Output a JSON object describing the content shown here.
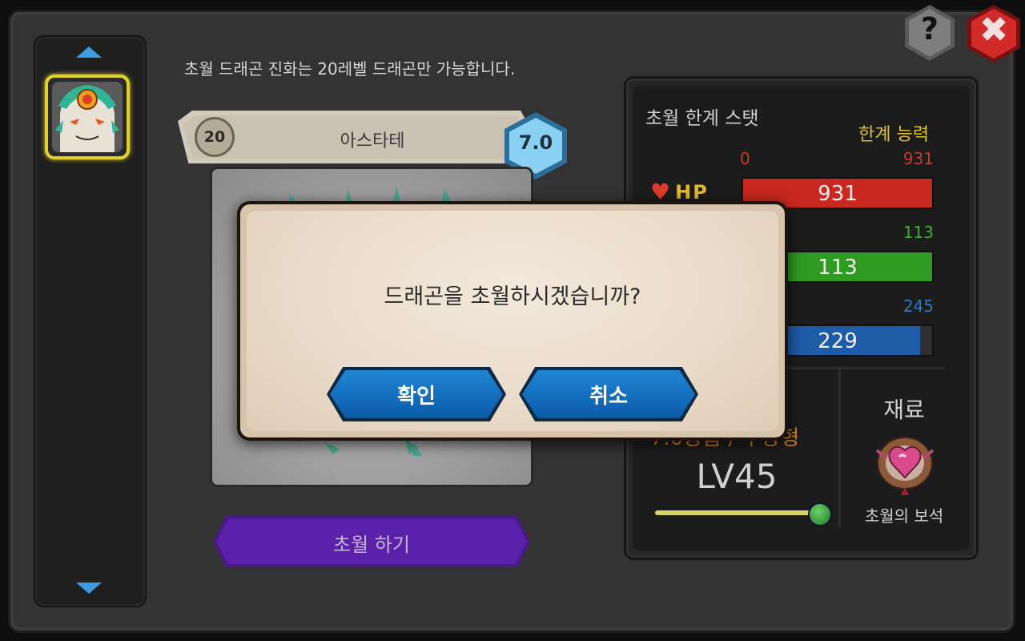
{
  "notice": "초월 드래곤 진화는 20레벨 드래곤만 가능합니다.",
  "dragon": {
    "level": "20",
    "name": "아스타테",
    "grade": "7.0"
  },
  "evolve_button": "초월 하기",
  "stats": {
    "title": "초월 한계 스탯",
    "limit_label": "한계 능력",
    "min": "0",
    "hp": {
      "label": "HP",
      "value": "931",
      "max": "931",
      "fraction": 1.0,
      "color": "#c7281f"
    },
    "attack": {
      "value": "113",
      "max": "113",
      "fraction": 1.0,
      "color": "#2f9a22"
    },
    "defense": {
      "value": "229",
      "max": "245",
      "fraction": 0.935,
      "color": "#1f5ca8"
    }
  },
  "info": {
    "attribute": "7.0등급 / 수방형",
    "level": "LV45",
    "slider_fraction": 1.0
  },
  "material": {
    "title": "재료",
    "name": "초월의 보석"
  },
  "dialog": {
    "message": "드래곤을 초월하시겠습니까?",
    "confirm": "확인",
    "cancel": "취소"
  },
  "help_glyph": "?",
  "close_glyph": "✖",
  "icons": {
    "up": "arrow-up-icon",
    "down": "arrow-down-icon",
    "heart": "heart-icon",
    "help": "help-icon",
    "close": "close-icon"
  }
}
